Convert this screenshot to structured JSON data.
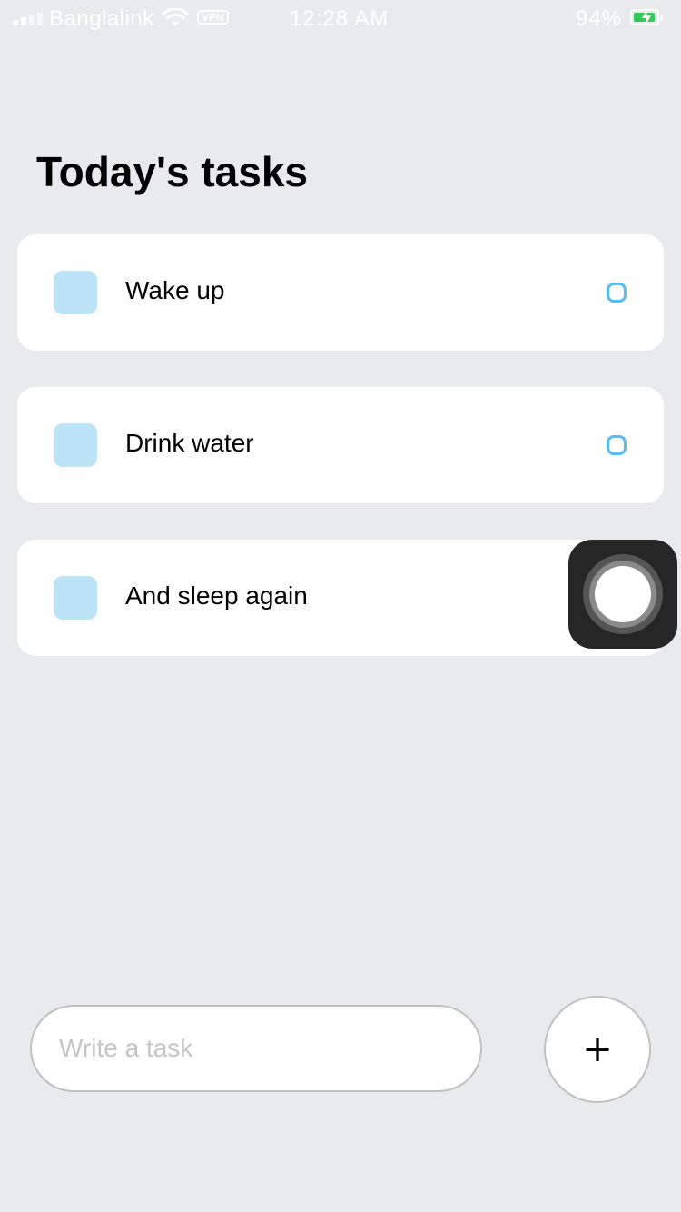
{
  "status_bar": {
    "carrier": "Banglalink",
    "vpn": "VPN",
    "time": "12:28 AM",
    "battery_percent": "94%",
    "battery_level": 0.94,
    "icons": [
      "signal-icon",
      "wifi-icon",
      "vpn-badge",
      "battery-icon",
      "charging-bolt-icon"
    ]
  },
  "page": {
    "title": "Today's tasks"
  },
  "tasks": [
    {
      "label": "Wake up"
    },
    {
      "label": "Drink water"
    },
    {
      "label": "And sleep again"
    }
  ],
  "composer": {
    "placeholder": "Write a task",
    "value": "",
    "add_label": "+"
  },
  "colors": {
    "background": "#e8eaed",
    "card": "#ffffff",
    "task_square": "#bde3f7",
    "task_circle": "#55bcf6",
    "assistive_touch": "#262626"
  }
}
